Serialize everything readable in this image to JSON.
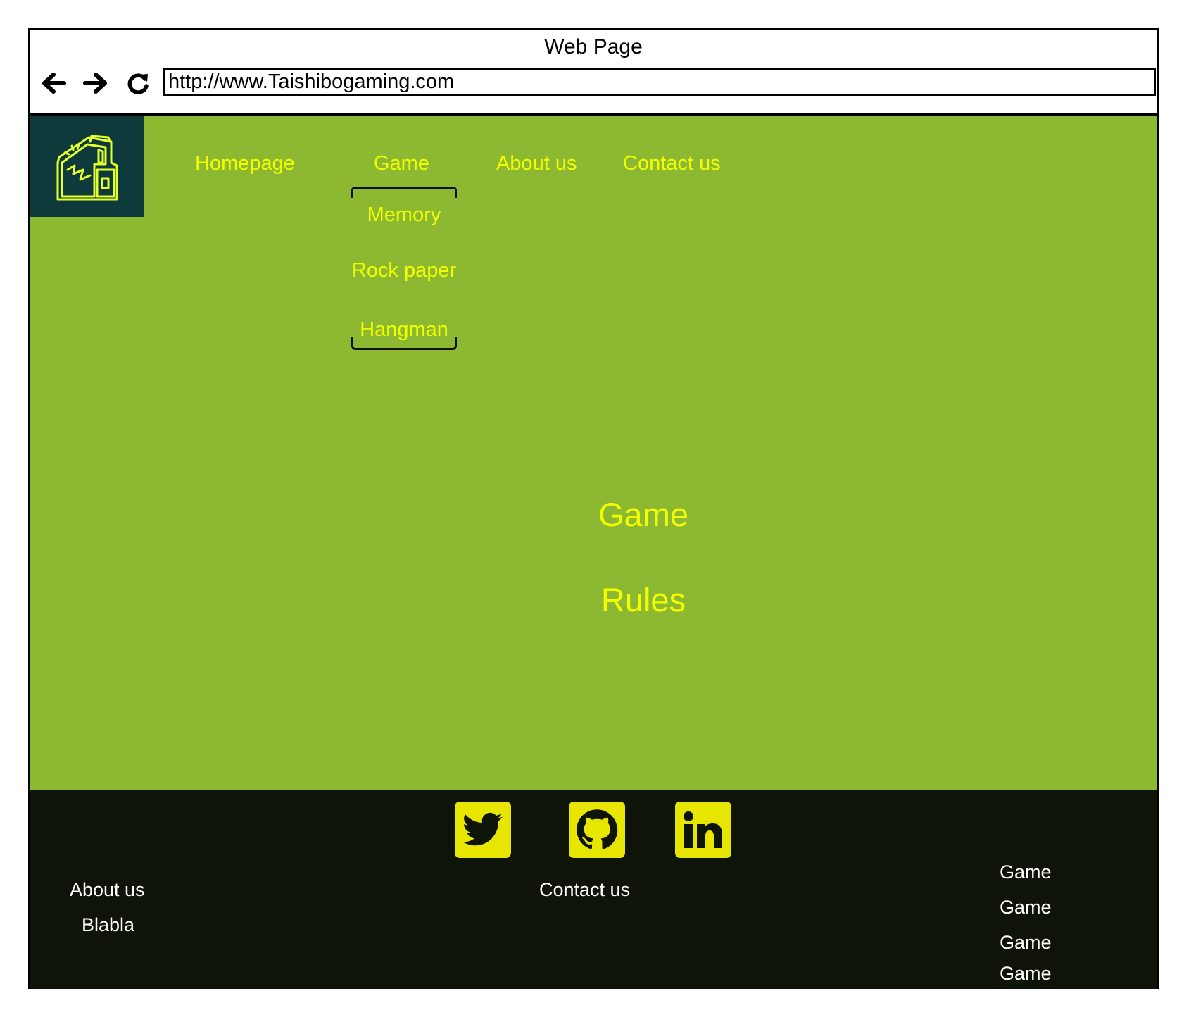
{
  "window": {
    "title": "Web Page",
    "url": "http://www.Taishibogaming.com"
  },
  "icons": {
    "back": "arrow-left-icon",
    "forward": "arrow-right-icon",
    "reload": "reload-icon",
    "logo": "arcade-cabinet-icon",
    "twitter": "twitter-icon",
    "github": "github-icon",
    "linkedin": "linkedin-icon"
  },
  "nav": {
    "items": [
      {
        "label": "Homepage"
      },
      {
        "label": "Game"
      },
      {
        "label": "About us"
      },
      {
        "label": "Contact us"
      }
    ],
    "dropdown": [
      {
        "label": "Memory"
      },
      {
        "label": "Rock paper"
      },
      {
        "label": "Hangman"
      }
    ]
  },
  "main": {
    "heading": "Game",
    "subheading": "Rules"
  },
  "footer": {
    "about_title": "About us",
    "about_body": "Blabla",
    "contact_title": "Contact us",
    "game_links": [
      {
        "label": "Game"
      },
      {
        "label": "Game"
      },
      {
        "label": "Game"
      },
      {
        "label": "Game"
      }
    ]
  },
  "colors": {
    "main_bg": "#8cb832",
    "logo_bg": "#0f3a3c",
    "nav_text": "#f2ff00",
    "footer_bg": "#0e1408",
    "footer_text": "#ffffff",
    "social_bg": "#e6e600"
  }
}
